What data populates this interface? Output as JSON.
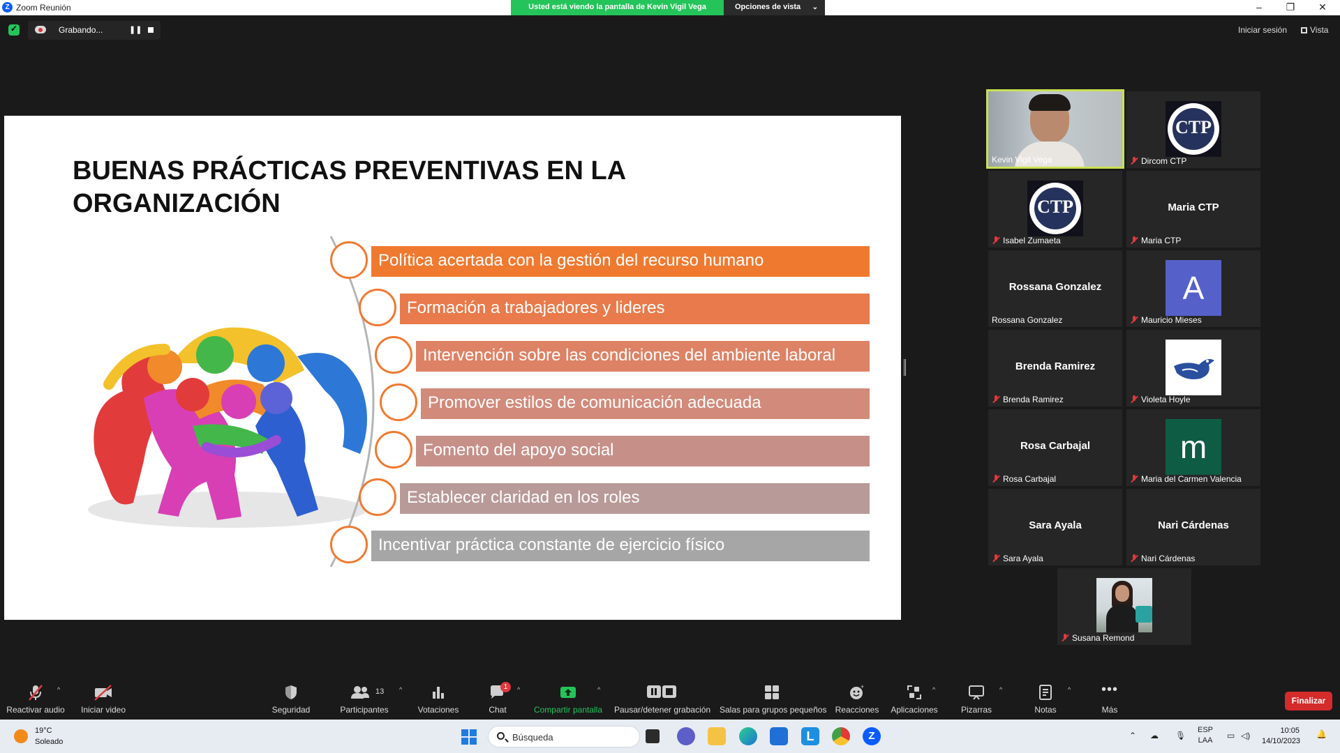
{
  "window": {
    "title": "Zoom Reunión",
    "share_banner": "Usted está viendo la pantalla de Kevin Vigil Vega",
    "view_options": "Opciones de vista",
    "controls": {
      "minimize": "–",
      "restore": "❐",
      "close": "✕"
    }
  },
  "meeting_bar": {
    "recording_label": "Grabando...",
    "signin": "Iniciar sesión",
    "view": "Vista"
  },
  "slide": {
    "title_line1": "BUENAS PRÁCTICAS PREVENTIVAS EN LA",
    "title_line2": "ORGANIZACIÓN",
    "items": [
      {
        "text": "Política acertada con la gestión del recurso humano",
        "color": "#f07930"
      },
      {
        "text": "Formación a trabajadores y lideres",
        "color": "#e97a4b"
      },
      {
        "text": "Intervención sobre las condiciones del ambiente laboral",
        "color": "#dd8265"
      },
      {
        "text": "Promover estilos de comunicación adecuada",
        "color": "#d28a7a"
      },
      {
        "text": "Fomento del apoyo social",
        "color": "#c69089"
      },
      {
        "text": "Establecer claridad en los roles",
        "color": "#b89a98"
      },
      {
        "text": "Incentivar práctica constante de ejercicio físico",
        "color": "#a6a6a6"
      }
    ]
  },
  "participants": [
    {
      "name": "Kevin Vigil Vega",
      "muted": false,
      "kind": "video-man"
    },
    {
      "name": "Dircom CTP",
      "muted": true,
      "kind": "seal"
    },
    {
      "name": "Isabel Zumaeta",
      "muted": true,
      "kind": "seal"
    },
    {
      "name": "Maria CTP",
      "muted": true,
      "kind": "name",
      "display": "Maria CTP"
    },
    {
      "name": "Rossana Gonzalez",
      "muted": false,
      "kind": "name",
      "display": "Rossana Gonzalez"
    },
    {
      "name": "Mauricio Mieses",
      "muted": true,
      "kind": "letter",
      "letter": "A",
      "color": "#5561c9"
    },
    {
      "name": "Brenda Ramirez",
      "muted": true,
      "kind": "name",
      "display": "Brenda Ramirez"
    },
    {
      "name": "Violeta Hoyle",
      "muted": true,
      "kind": "bird"
    },
    {
      "name": "Rosa Carbajal",
      "muted": true,
      "kind": "name",
      "display": "Rosa Carbajal"
    },
    {
      "name": "Maria del Carmen Valencia",
      "muted": true,
      "kind": "letter",
      "letter": "m",
      "color": "#0f5c44"
    },
    {
      "name": "Sara Ayala",
      "muted": true,
      "kind": "name",
      "display": "Sara Ayala"
    },
    {
      "name": "Nari Cárdenas",
      "muted": true,
      "kind": "name",
      "display": "Nari Cárdenas"
    },
    {
      "name": "Susana Remond",
      "muted": true,
      "kind": "photo-woman"
    }
  ],
  "toolbar": {
    "unmute": "Reactivar audio",
    "start_video": "Iniciar video",
    "security": "Seguridad",
    "participants": "Participantes",
    "participants_count": "13",
    "polls": "Votaciones",
    "chat": "Chat",
    "chat_badge": "1",
    "share": "Compartir pantalla",
    "pause_recording": "Pausar/detener grabación",
    "breakout": "Salas para grupos pequeños",
    "reactions": "Reacciones",
    "apps": "Aplicaciones",
    "whiteboards": "Pizarras",
    "notes": "Notas",
    "more": "Más",
    "end": "Finalizar"
  },
  "taskbar": {
    "temp": "19°C",
    "weather": "Soleado",
    "search_placeholder": "Búsqueda",
    "lang1": "ESP",
    "lang2": "LAA",
    "time": "10:05",
    "date": "14/10/2023"
  }
}
